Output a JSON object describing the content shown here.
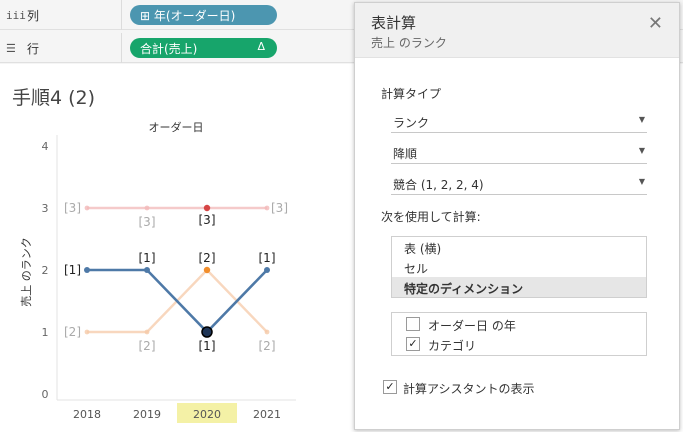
{
  "shelves": {
    "columns": {
      "icon": "iii",
      "label": "列",
      "pill_icon": "⊞",
      "pill_label": "年(オーダー日)"
    },
    "rows": {
      "icon": "☰",
      "label": "行",
      "pill_label": "合計(売上)",
      "pill_delta": "Δ"
    }
  },
  "sheet": {
    "title": "手順4 (2)"
  },
  "chart_data": {
    "type": "line",
    "header": "オーダー日",
    "ylabel": "売上 のランク",
    "x": [
      "2018",
      "2019",
      "2020",
      "2021"
    ],
    "highlighted_x": "2020",
    "ylim": [
      0,
      4
    ],
    "yticks": [
      0,
      1,
      2,
      3,
      4
    ],
    "series": [
      {
        "values": [
          2,
          2,
          1,
          2
        ],
        "labels": [
          "[1]",
          "[1]",
          "[1]",
          "[1]"
        ],
        "color": "#4e79a7",
        "emphasis": "strong"
      },
      {
        "values": [
          1,
          1,
          2,
          1
        ],
        "labels": [
          "[2]",
          "[2]",
          "[2]",
          "[2]"
        ],
        "color": "#f5c9a8",
        "emphasis": "faded"
      },
      {
        "values": [
          3,
          3,
          3,
          3
        ],
        "labels": [
          "[3]",
          "[3]",
          "[3]",
          "[3]"
        ],
        "color": "#f2b8b8",
        "emphasis": "faded"
      }
    ],
    "highlight_points": [
      {
        "series": 0,
        "x": "2020",
        "color": "#1f3556"
      },
      {
        "series": 1,
        "x": "2020",
        "color": "#f28e2b"
      },
      {
        "series": 2,
        "x": "2020",
        "color": "#d64545"
      }
    ]
  },
  "panel": {
    "title": "表計算",
    "subtitle": "売上 のランク",
    "close_icon": "✕",
    "calc_type_label": "計算タイプ",
    "dropdowns": [
      {
        "value": "ランク"
      },
      {
        "value": "降順"
      },
      {
        "value": "競合 (1, 2, 2, 4)"
      }
    ],
    "dropdown_arrow": "▼",
    "compute_using_label": "次を使用して計算:",
    "compute_options": [
      {
        "label": "表 (横)",
        "selected": false
      },
      {
        "label": "セル",
        "selected": false
      },
      {
        "label": "特定のディメンション",
        "selected": true
      }
    ],
    "dimensions": [
      {
        "label": "オーダー日 の年",
        "checked": false
      },
      {
        "label": "カテゴリ",
        "checked": true
      }
    ],
    "check_mark": "✓",
    "assistant": {
      "label": "計算アシスタントの表示",
      "checked": true
    }
  }
}
